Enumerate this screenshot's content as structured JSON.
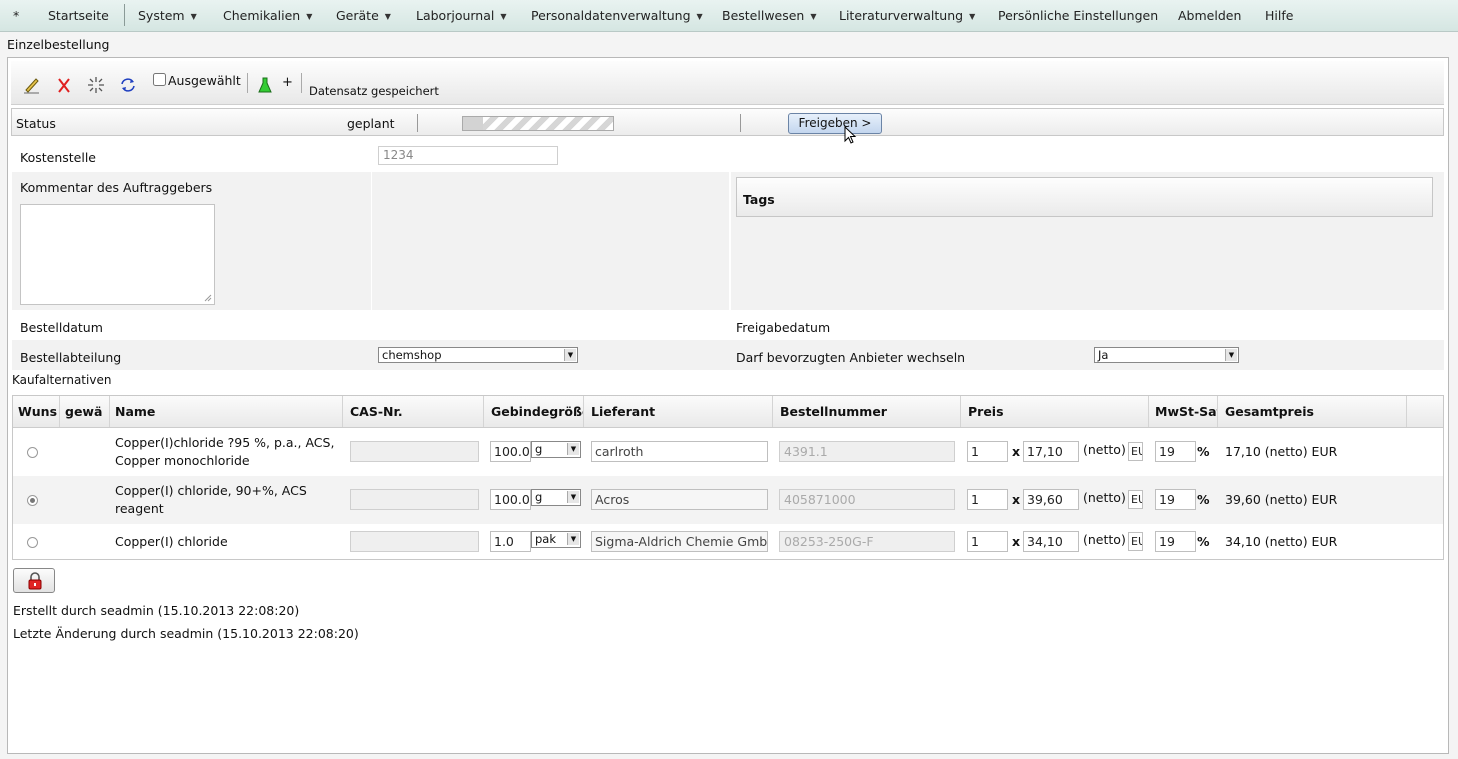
{
  "menu": {
    "items": [
      {
        "label": "*",
        "caret": false
      },
      {
        "label": "Startseite",
        "caret": false
      },
      {
        "label": "System",
        "caret": true
      },
      {
        "label": "Chemikalien",
        "caret": true
      },
      {
        "label": "Geräte",
        "caret": true
      },
      {
        "label": "Laborjournal",
        "caret": true
      },
      {
        "label": "Personaldatenverwaltung",
        "caret": true
      },
      {
        "label": "Bestellwesen",
        "caret": true
      },
      {
        "label": "Literaturverwaltung",
        "caret": true
      },
      {
        "label": "Persönliche Einstellungen",
        "caret": false
      },
      {
        "label": "Abmelden",
        "caret": false
      },
      {
        "label": "Hilfe",
        "caret": false
      }
    ]
  },
  "page": {
    "title": "Einzelbestellung"
  },
  "toolbar": {
    "selected_label": "Ausgewählt",
    "add_label": "+",
    "saved_message": "Datensatz gespeichert",
    "icons": [
      "edit-icon",
      "delete-icon",
      "new-icon",
      "refresh-icon",
      "flask-icon"
    ]
  },
  "status": {
    "label": "Status",
    "value": "geplant",
    "progress": 0.13,
    "release_button": "Freigeben >"
  },
  "form": {
    "cost_center_label": "Kostenstelle",
    "cost_center_value": "1234",
    "comment_label": "Kommentar des Auftraggebers",
    "tags_label": "Tags",
    "order_date_label": "Bestelldatum",
    "release_date_label": "Freigabedatum",
    "department_label": "Bestellabteilung",
    "department_value": "chemshop",
    "switch_vendor_label": "Darf bevorzugten Anbieter wechseln",
    "switch_vendor_value": "Ja"
  },
  "alternatives": {
    "title": "Kaufalternativen",
    "headers": [
      "Wuns",
      "gewä",
      "Name",
      "CAS-Nr.",
      "Gebindegröße",
      "Lieferant",
      "Bestellnummer",
      "Preis",
      "MwSt-Sat",
      "Gesamtpreis"
    ],
    "rows": [
      {
        "checked": false,
        "name": "Copper(I)chloride ?95 %, p.a., ACS, Copper monochloride",
        "cas": "",
        "amount": "100.0",
        "unit": "g",
        "supplier": "carlroth",
        "order_no": "4391.1",
        "qty": "1",
        "times": "x",
        "price": "17,10",
        "netto": "(netto)",
        "currency": "EU",
        "vat": "19",
        "percent": "%",
        "total": "17,10 (netto) EUR"
      },
      {
        "checked": true,
        "name": "Copper(I) chloride, 90+%, ACS reagent",
        "cas": "",
        "amount": "100.0",
        "unit": "g",
        "supplier": "Acros",
        "order_no": "405871000",
        "qty": "1",
        "times": "x",
        "price": "39,60",
        "netto": "(netto)",
        "currency": "EU",
        "vat": "19",
        "percent": "%",
        "total": "39,60 (netto) EUR"
      },
      {
        "checked": false,
        "name": "Copper(I) chloride",
        "cas": "",
        "amount": "1.0",
        "unit": "pak",
        "supplier": "Sigma-Aldrich Chemie GmbH",
        "order_no": "08253-250G-F",
        "qty": "1",
        "times": "x",
        "price": "34,10",
        "netto": "(netto)",
        "currency": "EU",
        "vat": "19",
        "percent": "%",
        "total": "34,10 (netto) EUR"
      }
    ]
  },
  "footer": {
    "created": "Erstellt durch seadmin (15.10.2013 22:08:20)",
    "modified": "Letzte Änderung durch seadmin (15.10.2013 22:08:20)"
  }
}
